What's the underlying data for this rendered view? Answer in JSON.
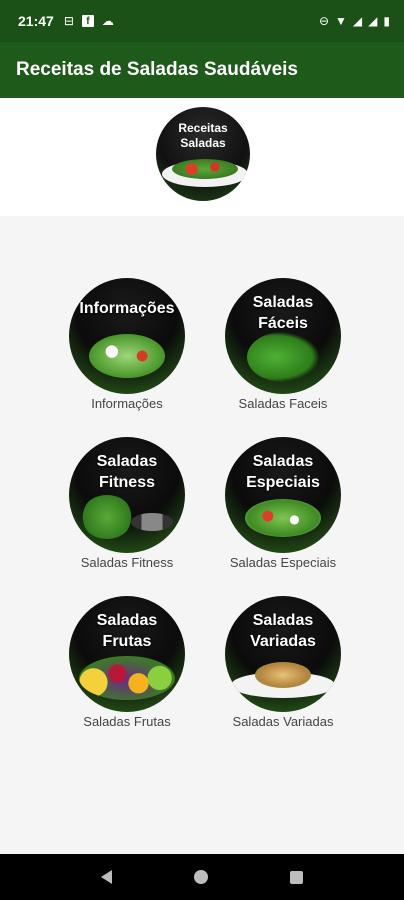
{
  "status_bar": {
    "time": "21:47",
    "icons": [
      "sim-icon",
      "facebook-icon",
      "cloud-icon",
      "dnd-icon",
      "wifi-icon",
      "signal-icon",
      "signal-icon",
      "battery-icon"
    ]
  },
  "app_bar": {
    "title": "Receitas de Saladas Saudáveis"
  },
  "header": {
    "logo_text_line1": "Receitas",
    "logo_text_line2": "Saladas"
  },
  "grid": [
    {
      "image_text_line1": "Informações",
      "image_text_line2": "",
      "label": "Informações"
    },
    {
      "image_text_line1": "Saladas",
      "image_text_line2": "Fáceis",
      "label": "Saladas Faceis"
    },
    {
      "image_text_line1": "Saladas",
      "image_text_line2": "Fitness",
      "label": "Saladas Fitness"
    },
    {
      "image_text_line1": "Saladas",
      "image_text_line2": "Especiais",
      "label": "Saladas Especiais"
    },
    {
      "image_text_line1": "Saladas",
      "image_text_line2": "Frutas",
      "label": "Saladas Frutas"
    },
    {
      "image_text_line1": "Saladas",
      "image_text_line2": "Variadas",
      "label": "Saladas Variadas"
    }
  ],
  "nav_bar": {
    "buttons": [
      "back",
      "home",
      "recents"
    ]
  },
  "colors": {
    "status_bar": "#1b5016",
    "app_bar": "#1e5a1a",
    "background": "#f5f5f5"
  }
}
